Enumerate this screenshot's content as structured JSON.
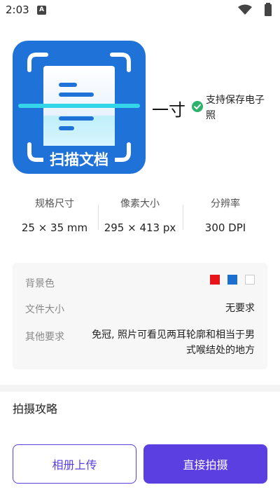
{
  "status_bar": {
    "time": "2:03",
    "notification_icon": "A",
    "icons": [
      "wifi-icon",
      "battery-icon"
    ]
  },
  "app_logo": {
    "text": "扫描文档",
    "color": "#1f73d8",
    "scan_line_color": "#33d6e8"
  },
  "header": {
    "size_label": "一寸",
    "support_text": "支持保存电子照",
    "check_color": "#2db36b"
  },
  "specs": [
    {
      "title": "规格尺寸",
      "value": "25 × 35 mm"
    },
    {
      "title": "像素大小",
      "value": "295 × 413 px"
    },
    {
      "title": "分辨率",
      "value": "300 DPI"
    }
  ],
  "requirements": {
    "background": {
      "label": "背景色",
      "colors": [
        "#e8141b",
        "#1c6fd1",
        "#ffffff"
      ]
    },
    "file_size": {
      "label": "文件大小",
      "value": "无要求"
    },
    "other": {
      "label": "其他要求",
      "value_line1": "免冠, 照片可看见两耳轮廓和相当于男",
      "value_line2": "式喉结处的地方"
    }
  },
  "guide": {
    "title": "拍摄攻略"
  },
  "actions": {
    "album_label": "相册上传",
    "camera_label": "直接拍摄",
    "accent": "#5b3fe0"
  }
}
